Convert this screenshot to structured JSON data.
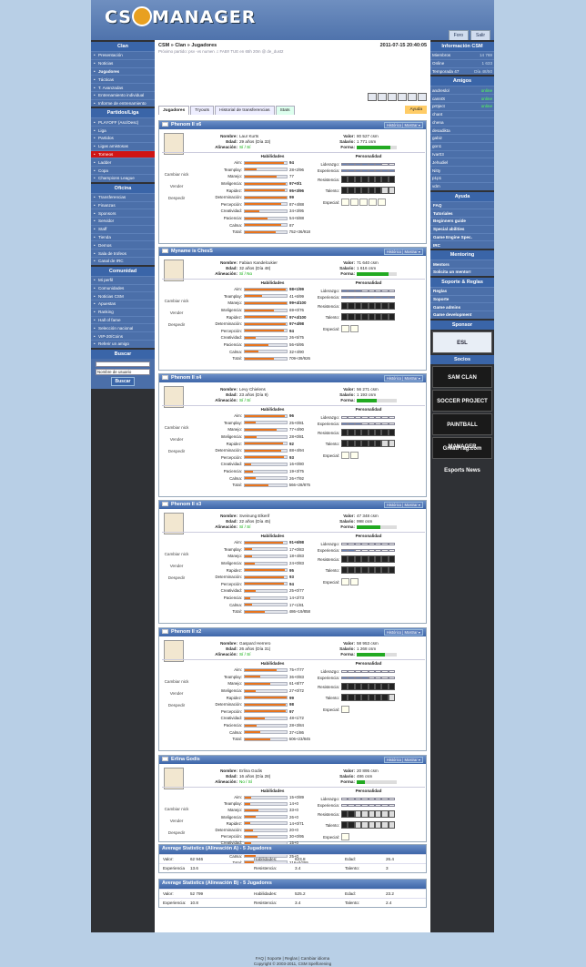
{
  "app": {
    "logo": "CSManager",
    "top_buttons": [
      "Foro",
      "Salir"
    ]
  },
  "left": {
    "clan_title": "Clan",
    "clan": [
      "Presentación",
      "Noticias",
      "Jugadores",
      "Tácticas",
      "T. Avanzadas",
      "Entrenamiento individual",
      "Informe de entrenamiento"
    ],
    "partidos_title": "Partidos/Liga",
    "partidos": [
      "PLAYOFF (Asc/Desc)",
      "Liga",
      "Partidos",
      "Ligas amistosas",
      "Torneos",
      "Ladder",
      "Copa",
      "Champions League"
    ],
    "oficina_title": "Oficina",
    "oficina": [
      "Transferencias",
      "Finanzas",
      "Sponsors",
      "Servidor",
      "Staff",
      "Tienda",
      "Demos",
      "Sala de trofeos",
      "Canal de IRC"
    ],
    "comunidad_title": "Comunidad",
    "comunidad": [
      "Mi perfil",
      "Comunidades",
      "Noticias CSM",
      "Apuestas",
      "Ranking",
      "Hall of fame",
      "Selección nacional",
      "VIP-20/Coins",
      "Referir un amigo"
    ],
    "buscar_title": "Buscar",
    "buscar_select": "Nombre de usuario",
    "buscar_button": "Buscar"
  },
  "right": {
    "info_title": "Información CSM",
    "info": [
      {
        "k": "Miembros",
        "v": "14 769"
      },
      {
        "k": "Online",
        "v": "1 633"
      },
      {
        "k": "Temporada 47",
        "v": "Día 48/50"
      }
    ],
    "amigos_title": "Amigos",
    "amigos": [
      {
        "n": "andreslol",
        "s": "online"
      },
      {
        "n": "cann0t",
        "s": "online"
      },
      {
        "n": "pr0ject",
        "s": "online"
      },
      {
        "n": "chant",
        "s": ""
      },
      {
        "n": "chena",
        "s": ""
      },
      {
        "n": "desadikta",
        "s": ""
      },
      {
        "n": "gabiz",
        "s": ""
      },
      {
        "n": "gon1",
        "s": ""
      },
      {
        "n": "Ivar03",
        "s": ""
      },
      {
        "n": "Jehudiel",
        "s": ""
      },
      {
        "n": "Nitty",
        "s": ""
      },
      {
        "n": "p1p1",
        "s": ""
      },
      {
        "n": "vdm",
        "s": ""
      }
    ],
    "ayuda_title": "Ayuda",
    "ayuda": [
      "FAQ",
      "Tutoriales",
      "Beginners guide",
      "Special abilities",
      "Game Engine Spec.",
      "IRC"
    ],
    "mentoring_title": "Mentoring",
    "mentoring": [
      "Mentors",
      "Solicita un mentor!"
    ],
    "soporte_title": "Soporte & Reglas",
    "soporte": [
      "Reglas",
      "Soporte",
      "Game admins",
      "Game development"
    ],
    "sponsor_title": "Sponsor",
    "sponsor": "ESL",
    "socios_title": "Socios",
    "socios": [
      "SAM CLAN",
      "SOCCER PROJECT",
      "PAINTBALL MANAGER",
      "GreatFrag.com Esports News"
    ]
  },
  "main": {
    "crumb": "CSM » Clan » Jugadores",
    "datetime": "2011-07-15 20:40:05",
    "next": "Próximo partido: psv -vs numen ♫ FAB!! TUE en 65h 20m @ de_dust2",
    "tabs": [
      "Jugadores",
      "Tryouts",
      "Historial de transferencias",
      "Stats"
    ],
    "ayuda": "Ayuda",
    "labels": {
      "nombre": "Nombre:",
      "edad": "Edad:",
      "alin": "Alineación:",
      "valor": "Valor:",
      "salario": "Salario:",
      "forma": "Forma:",
      "hab": "Habilidades",
      "pers": "Personalidad",
      "cambiar": "Cambiar nick",
      "vender": "Vender",
      "despedir": "Despedir",
      "hist": "Histórico | Mostrar ▾",
      "lid": "Liderazgo:",
      "exp": "Experiencia:",
      "res": "Resistencia:",
      "tal": "Talento:",
      "esp": "Especial:"
    },
    "skill_names": [
      "Aim:",
      "Teamplay:",
      "Manejo:",
      "Inteligencia:",
      "Rapidez:",
      "Determinación:",
      "Percepción:",
      "Creatividad:",
      "Paciencia:",
      "Calma:",
      "Total:"
    ],
    "players": [
      {
        "nick": "Phenom II x6",
        "name": "Laur Kurts",
        "age": "29 años (Día 33)",
        "al": "Sí / Sí",
        "val": "80 527 csm",
        "sal": "1 771 csm",
        "forma": 0.85,
        "sk": [
          "94",
          "28+2/96",
          "77",
          "97+0/1",
          "95+3/96",
          "99",
          "87+4/88",
          "34+3/95",
          "54+5/88",
          "87",
          "752+36/918"
        ],
        "sv": [
          94,
          28,
          77,
          97,
          95,
          99,
          87,
          34,
          54,
          87
        ],
        "lid": 6,
        "exp": 8,
        "res": 8,
        "tal": 6,
        "esp": 5
      },
      {
        "nick": "Myname is ChesS",
        "name": "Fabian Kandelcukier",
        "age": "32 años (Día 48)",
        "al": "Sí / No",
        "val": "71 640 csm",
        "sal": "1 616 csm",
        "forma": 0.8,
        "sk": [
          "98+1/99",
          "41+6/99",
          "99+4/100",
          "69+0/76",
          "97+4/100",
          "97+4/98",
          "94",
          "26+5/75",
          "56+5/95",
          "32+4/90",
          "709+39/926"
        ],
        "sv": [
          98,
          41,
          99,
          69,
          97,
          97,
          94,
          26,
          56,
          32
        ],
        "lid": 3,
        "exp": 8,
        "res": 8,
        "tal": 8,
        "esp": 2
      },
      {
        "nick": "Phenom II x4",
        "name": "Levy Chielens",
        "age": "23 años (Día 9)",
        "al": "Sí / Sí",
        "val": "56 271 csm",
        "sal": "1 193 csm",
        "forma": 0.5,
        "sk": [
          "96",
          "25+0/81",
          "77+4/90",
          "28+0/81",
          "92",
          "88+4/94",
          "93",
          "16+0/80",
          "19+3/75",
          "26+7/92",
          "566+28/875"
        ],
        "sv": [
          96,
          25,
          77,
          28,
          92,
          88,
          93,
          16,
          19,
          26
        ],
        "lid": 0,
        "exp": 3,
        "res": 8,
        "tal": 6,
        "esp": 2
      },
      {
        "nick": "Phenom II x3",
        "name": "Sveinung Elkerif",
        "age": "22 años (Día 45)",
        "al": "Sí / Sí",
        "val": "47 348 csm",
        "sal": "998 csm",
        "forma": 0.6,
        "sk": [
          "91+6/98",
          "17+0/83",
          "18+4/83",
          "24+0/83",
          "95",
          "93",
          "94",
          "25+0/77",
          "14+2/73",
          "17+1/81",
          "486+19/858"
        ],
        "sv": [
          91,
          17,
          18,
          24,
          95,
          93,
          94,
          25,
          14,
          17
        ],
        "lid": 0,
        "exp": 2,
        "res": 8,
        "tal": 8,
        "esp": 2
      },
      {
        "nick": "Phenom II x2",
        "name": "Gaspard Herrero",
        "age": "26 años (Día 31)",
        "al": "Sí / Sí",
        "val": "58 953 csm",
        "sal": "1 268 csm",
        "forma": 0.7,
        "sk": [
          "75+7/77",
          "36+0/83",
          "61+8/77",
          "27+0/72",
          "99",
          "98",
          "97",
          "48+1/72",
          "28+3/84",
          "37+1/86",
          "606+23/845"
        ],
        "sv": [
          75,
          36,
          61,
          27,
          99,
          98,
          97,
          48,
          28,
          37
        ],
        "lid": 0,
        "exp": 4,
        "res": 8,
        "tal": 7,
        "esp": 1
      },
      {
        "nick": "Erlina Godis",
        "name": "Erlina Godis",
        "age": "16 años (Día 28)",
        "al": "No / Sí",
        "val": "20 895 csm",
        "sal": "486 csm",
        "forma": 0.2,
        "sk": [
          "15+0/89",
          "14+0",
          "33+0",
          "26+0",
          "14+0/71",
          "20+0",
          "30+0/95",
          "15+0",
          "24+0",
          "25+0",
          "216+0/255"
        ],
        "sv": [
          15,
          14,
          33,
          26,
          14,
          20,
          30,
          15,
          24,
          25
        ],
        "lid": 0,
        "exp": 0,
        "res": 2,
        "tal": 2,
        "esp": 1
      }
    ],
    "avgA": {
      "title": "Average Statistics (Alineación A) - 5 Jugadores",
      "r1": [
        "Valor:",
        "62 946",
        "Habilidades:",
        "623.8",
        "Edad:",
        "26.4"
      ],
      "r2": [
        "Experiencia",
        "13.6",
        "Resistencia:",
        "3.4",
        "Talento:",
        "3"
      ]
    },
    "avgB": {
      "title": "Average Statistics (Alineación B) - 5 Jugadores",
      "r1": [
        "Valor:",
        "52 799",
        "Habilidades:",
        "525.2",
        "Edad:",
        "23.2"
      ],
      "r2": [
        "Experiencia:",
        "10.8",
        "Resistencia:",
        "3.4",
        "Talento:",
        "2.4"
      ]
    },
    "foot1": "FAQ | Soporte | Reglas | Cambiar idioma",
    "foot2": "Copyright © 2003-2011, CSM Spelforening"
  }
}
